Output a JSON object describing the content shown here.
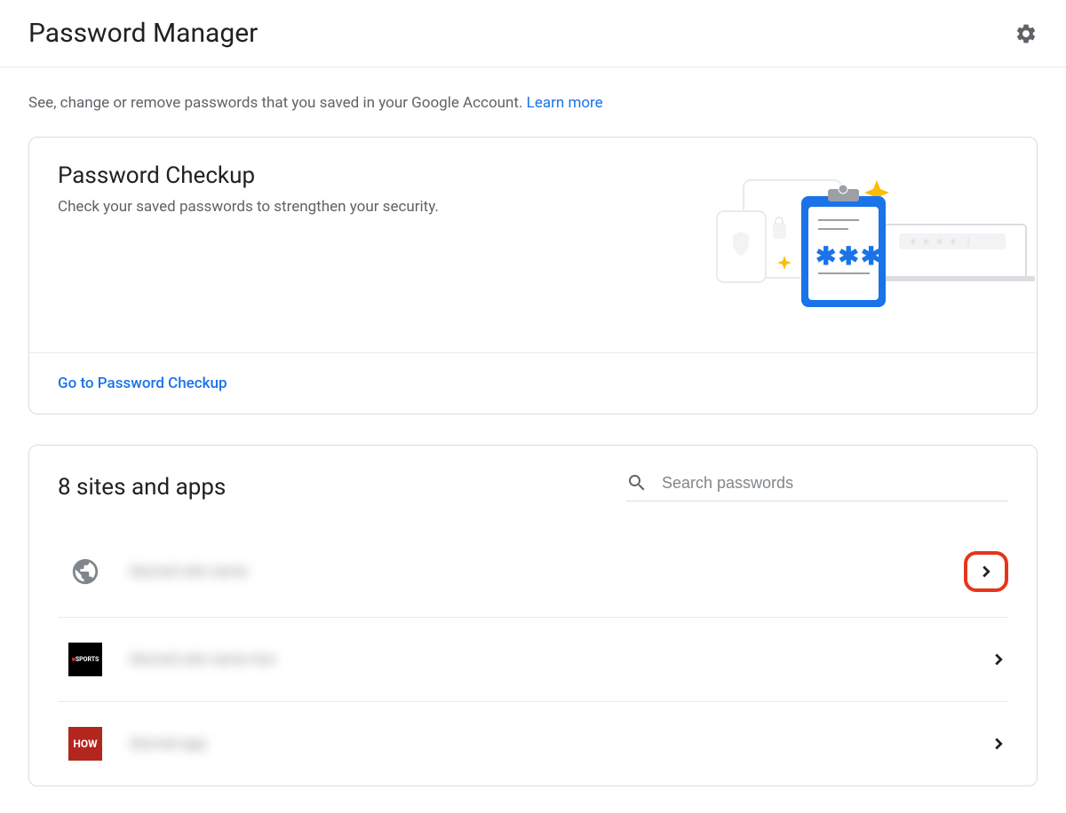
{
  "header": {
    "title": "Password Manager"
  },
  "intro": {
    "text": "See, change or remove passwords that you saved in your Google Account. ",
    "learn_more": "Learn more"
  },
  "checkup": {
    "title": "Password Checkup",
    "subtitle": "Check your saved passwords to strengthen your security.",
    "link_label": "Go to Password Checkup"
  },
  "sites": {
    "title": "8 sites and apps",
    "search_placeholder": "Search passwords",
    "items": [
      {
        "label": "blurred site name"
      },
      {
        "label": "blurred site name two"
      },
      {
        "label": "blurred app"
      }
    ],
    "favicon_sports_label": "SPORTS",
    "favicon_how_label": "HOW"
  }
}
